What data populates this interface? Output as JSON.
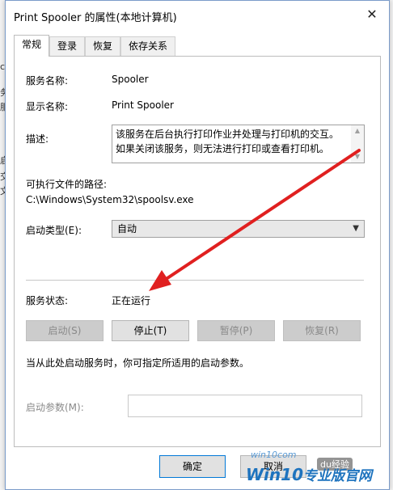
{
  "window": {
    "title": "Print Spooler 的属性(本地计算机)",
    "close_glyph": "✕"
  },
  "tabs": [
    {
      "label": "常规",
      "active": true
    },
    {
      "label": "登录",
      "active": false
    },
    {
      "label": "恢复",
      "active": false
    },
    {
      "label": "依存关系",
      "active": false
    }
  ],
  "general": {
    "service_name_label": "服务名称:",
    "service_name_value": "Spooler",
    "display_name_label": "显示名称:",
    "display_name_value": "Print Spooler",
    "description_label": "描述:",
    "description_value": "该服务在后台执行打印作业并处理与打印机的交互。如果关闭该服务，则无法进行打印或查看打印机。",
    "path_label": "可执行文件的路径:",
    "path_value": "C:\\Windows\\System32\\spoolsv.exe",
    "startup_type_label": "启动类型(E):",
    "startup_type_value": "自动",
    "status_label": "服务状态:",
    "status_value": "正在运行",
    "buttons": {
      "start": "启动(S)",
      "stop": "停止(T)",
      "pause": "暂停(P)",
      "resume": "恢复(R)"
    },
    "hint": "当从此处启动服务时，你可指定所适用的启动参数。",
    "params_label": "启动参数(M):",
    "params_value": ""
  },
  "footer": {
    "ok": "确定",
    "cancel": "取消"
  },
  "background_fragments": [
    "务",
    "服",
    "启",
    "交",
    "文",
    "c"
  ],
  "watermark": {
    "site": "win10com",
    "logo": "Win10",
    "logo_cn": "专业版官网",
    "baidu": "du经验"
  },
  "colors": {
    "annotation_arrow": "#e02020",
    "accent": "#0078d7"
  }
}
